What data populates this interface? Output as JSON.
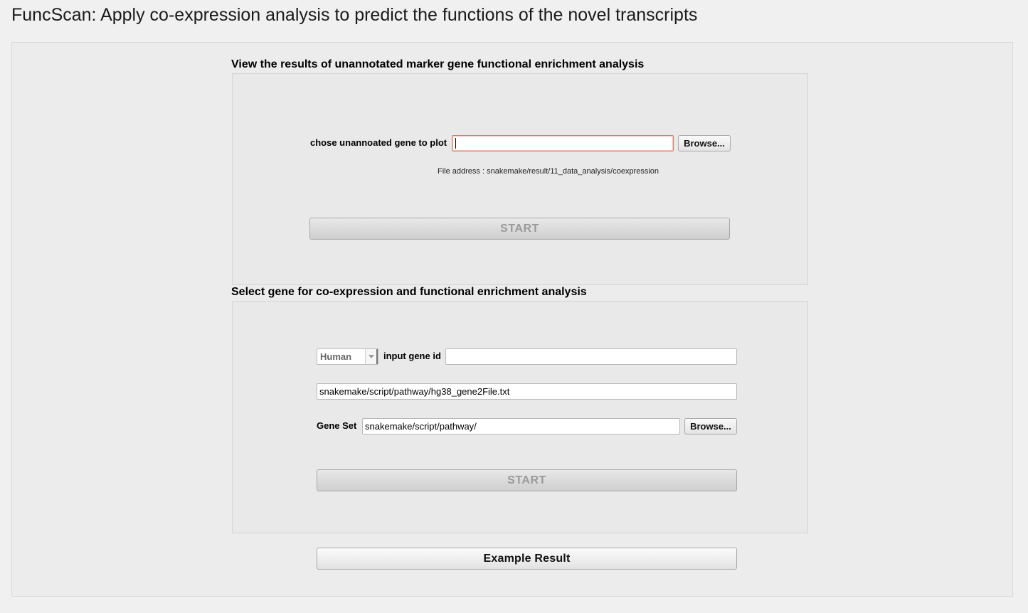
{
  "page": {
    "title": "FuncScan: Apply co-expression analysis to predict the functions of the novel transcripts"
  },
  "section1": {
    "title": "View the results of unannotated marker gene functional enrichment analysis",
    "gene_label": "chose unannoated gene to plot",
    "gene_input_value": "",
    "browse_label": "Browse...",
    "file_address": "File address : snakemake/result/11_data_analysis/coexpression",
    "start_label": "START"
  },
  "section2": {
    "title": "Select gene for co-expression and functional enrichment analysis",
    "species_selected": "Human",
    "gene_id_label": "input gene id",
    "gene_id_value": "",
    "gene2file_value": "snakemake/script/pathway/hg38_gene2File.txt",
    "gene_set_label": "Gene Set",
    "gene_set_value": "snakemake/script/pathway/",
    "browse_label": "Browse...",
    "start_label": "START"
  },
  "footer": {
    "example_label": "Example Result"
  }
}
